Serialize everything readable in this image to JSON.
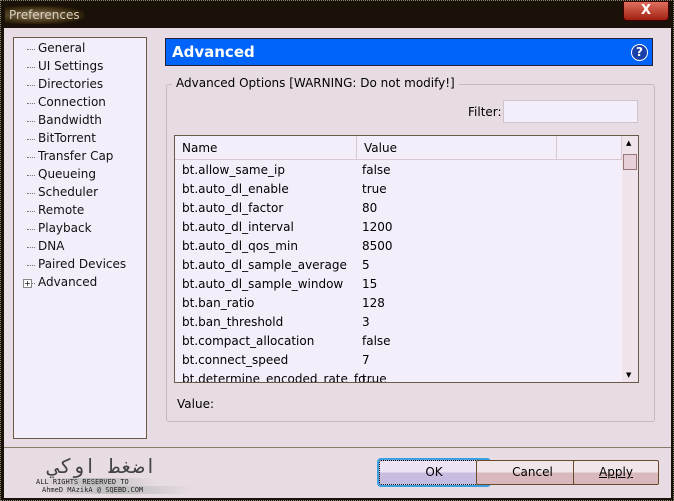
{
  "window": {
    "title": "Preferences",
    "close_label": "X"
  },
  "sidebar": {
    "items": [
      "General",
      "UI Settings",
      "Directories",
      "Connection",
      "Bandwidth",
      "BitTorrent",
      "Transfer Cap",
      "Queueing",
      "Scheduler",
      "Remote",
      "Playback",
      "DNA",
      "Paired Devices",
      "Advanced"
    ],
    "selected": "Advanced"
  },
  "header": {
    "title": "Advanced",
    "help": "?"
  },
  "group": {
    "label": "Advanced Options [WARNING: Do not modify!]",
    "filter_label": "Filter:",
    "filter_value": ""
  },
  "table": {
    "columns": [
      "Name",
      "Value"
    ],
    "rows": [
      [
        "bt.allow_same_ip",
        "false"
      ],
      [
        "bt.auto_dl_enable",
        "true"
      ],
      [
        "bt.auto_dl_factor",
        "80"
      ],
      [
        "bt.auto_dl_interval",
        "1200"
      ],
      [
        "bt.auto_dl_qos_min",
        "8500"
      ],
      [
        "bt.auto_dl_sample_average",
        "5"
      ],
      [
        "bt.auto_dl_sample_window",
        "15"
      ],
      [
        "bt.ban_ratio",
        "128"
      ],
      [
        "bt.ban_threshold",
        "3"
      ],
      [
        "bt.compact_allocation",
        "false"
      ],
      [
        "bt.connect_speed",
        "7"
      ],
      [
        "bt.determine_encoded_rate_fo...",
        "true"
      ]
    ]
  },
  "value_label": "Value:",
  "buttons": {
    "ok": "OK",
    "cancel": "Cancel",
    "apply": "Apply"
  },
  "watermark": {
    "arabic": "اضغط اوكي",
    "line1": "ALL RIGHTS RESERVED TO",
    "line2": "AhmeD MAzikA @ SQEBD.COM"
  }
}
